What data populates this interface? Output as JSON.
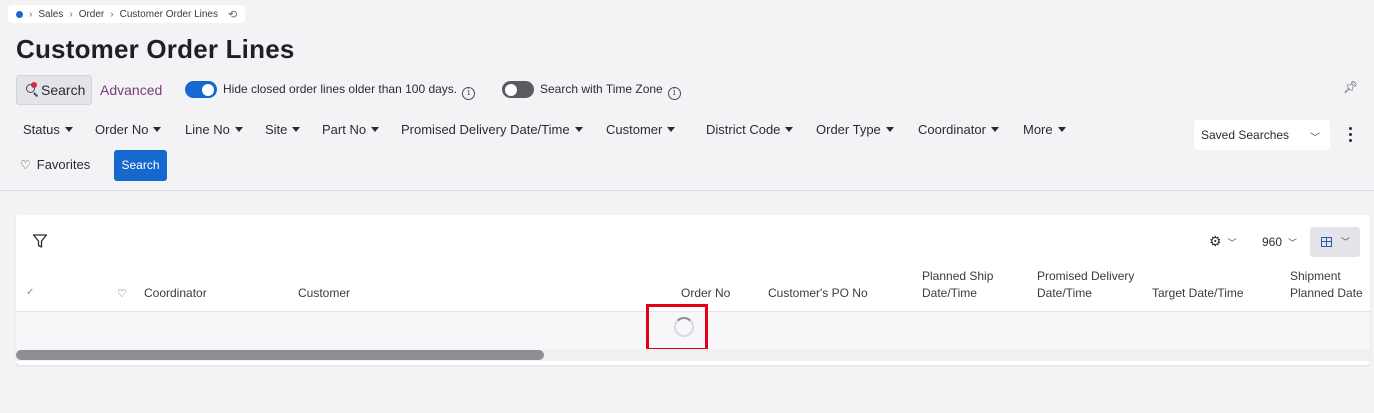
{
  "breadcrumb": {
    "items": [
      "Sales",
      "Order",
      "Customer Order Lines"
    ]
  },
  "page": {
    "title": "Customer Order Lines"
  },
  "search_tabs": {
    "search": "Search",
    "advanced": "Advanced"
  },
  "toggles": {
    "hide_closed": {
      "label": "Hide closed order lines older than 100 days.",
      "on": true
    },
    "time_zone": {
      "label": "Search with Time Zone",
      "on": false
    }
  },
  "filters": [
    "Status",
    "Order No",
    "Line No",
    "Site",
    "Part No",
    "Promised Delivery Date/Time",
    "Customer",
    "District Code",
    "Order Type",
    "Coordinator",
    "More"
  ],
  "saved_searches": {
    "label": "Saved Searches"
  },
  "favorites": {
    "label": "Favorites"
  },
  "search_button": {
    "label": "Search"
  },
  "grid": {
    "row_count": "960",
    "columns": [
      "Coordinator",
      "Customer",
      "Order No",
      "Customer's PO No",
      "Planned Ship Date/Time",
      "Promised Delivery Date/Time",
      "Target Date/Time",
      "Shipment Planned Date"
    ],
    "loading": true,
    "scroll_fraction": 0.39
  },
  "colors": {
    "accent": "#1668cf",
    "advanced_text": "#7a3a7a",
    "highlight": "#e0001a"
  },
  "icons": {
    "home": "home-dot-icon",
    "refresh": "refresh-icon",
    "search": "search-icon",
    "info": "info-icon",
    "pin": "pin-icon",
    "filter": "funnel-icon",
    "settings": "gear-icon",
    "table_view": "table-icon"
  }
}
